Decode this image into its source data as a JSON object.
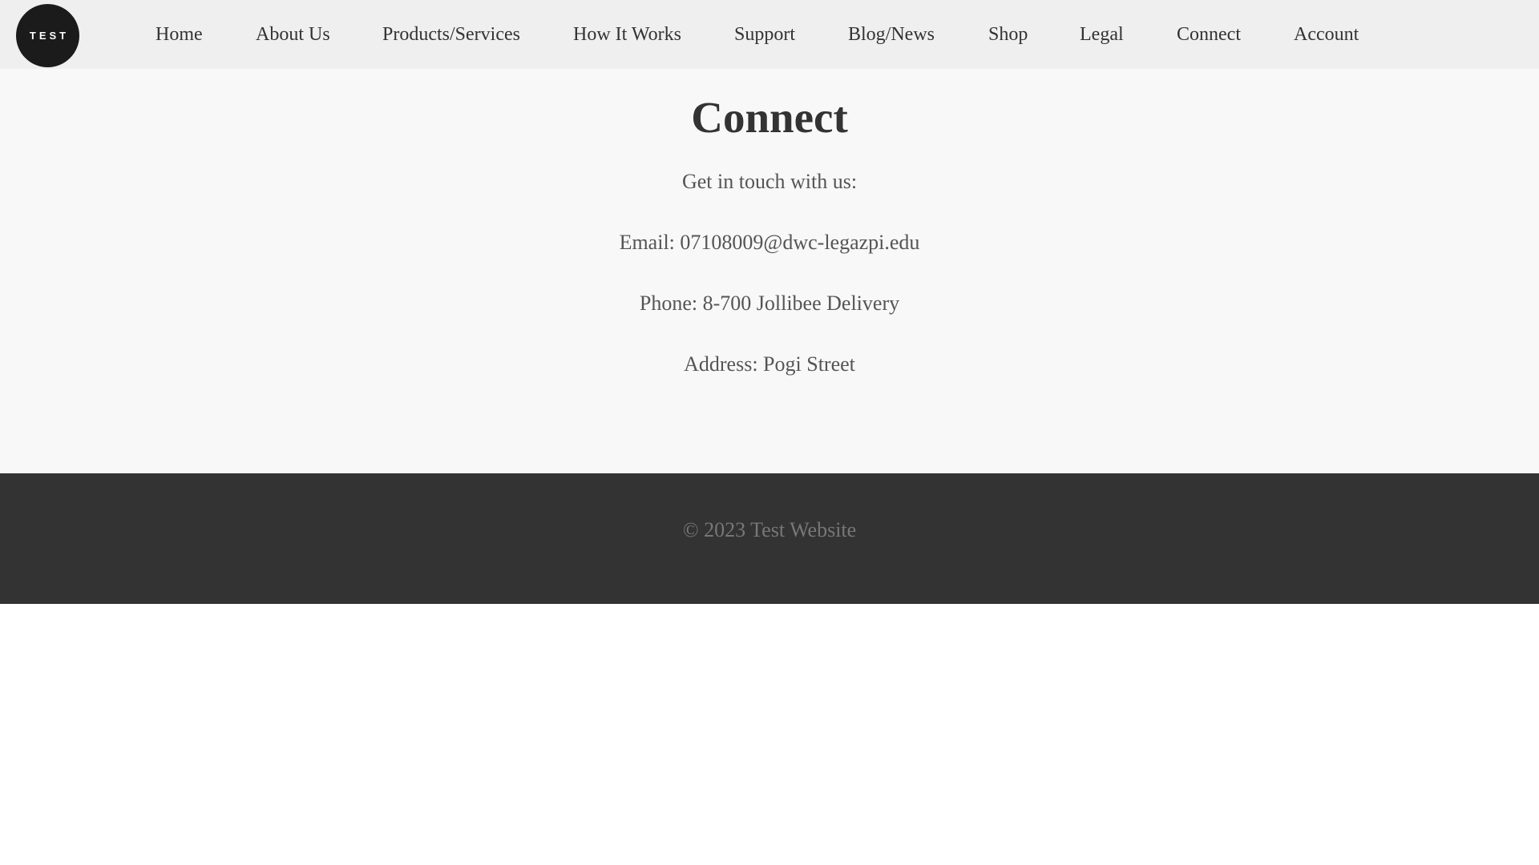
{
  "header": {
    "logo_text": "TEST",
    "nav": [
      {
        "label": "Home"
      },
      {
        "label": "About Us"
      },
      {
        "label": "Products/Services"
      },
      {
        "label": "How It Works"
      },
      {
        "label": "Support"
      },
      {
        "label": "Blog/News"
      },
      {
        "label": "Shop"
      },
      {
        "label": "Legal"
      },
      {
        "label": "Connect"
      },
      {
        "label": "Account"
      }
    ]
  },
  "main": {
    "title": "Connect",
    "intro": "Get in touch with us:",
    "email": "Email: 07108009@dwc-legazpi.edu",
    "phone": "Phone: 8-700 Jollibee Delivery",
    "address": "Address: Pogi Street"
  },
  "footer": {
    "copyright": "© 2023 Test Website"
  },
  "colors": {
    "header_bg": "#efefef",
    "main_bg": "#f8f8f8",
    "footer_bg": "#333333",
    "logo_bg": "#1b1b1b"
  }
}
